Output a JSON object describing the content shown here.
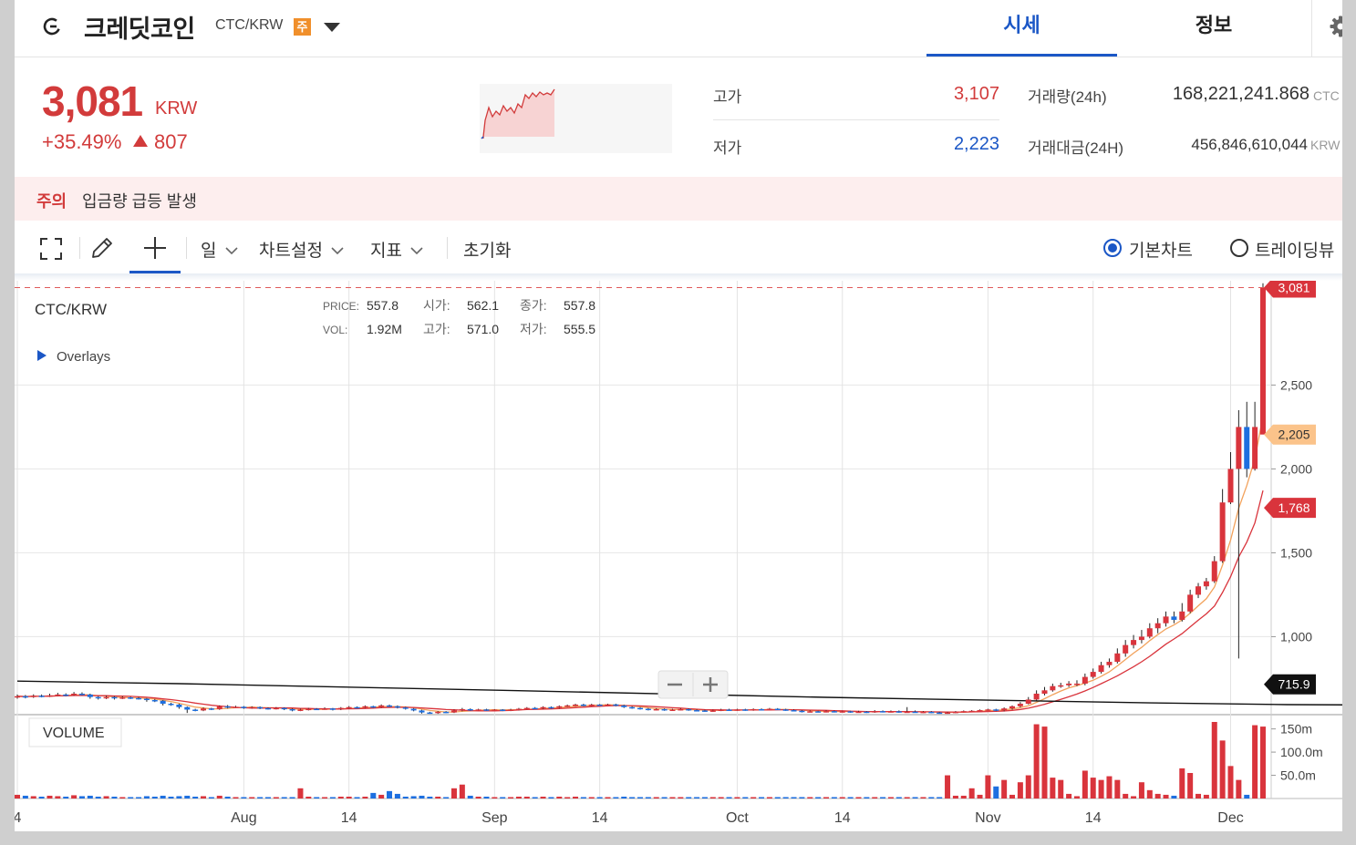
{
  "header": {
    "coin_name": "크레딧코인",
    "pair": "CTC/KRW",
    "warning_badge": "주",
    "tab_price": "시세",
    "tab_info": "정보"
  },
  "price": {
    "current": "3,081",
    "unit": "KRW",
    "change_pct": "+35.49%",
    "change_abs": "807",
    "up_color": "#d23b3b",
    "down_color": "#1b57c6"
  },
  "stats": {
    "high_label": "고가",
    "high_value": "3,107",
    "low_label": "저가",
    "low_value": "2,223",
    "volume_label": "거래량(24h)",
    "volume_value": "168,221,241.868",
    "volume_unit": "CTC",
    "amount_label": "거래대금(24H)",
    "amount_value": "456,846,610,044",
    "amount_unit": "KRW"
  },
  "alert": {
    "tag": "주의",
    "text": "입금량 급등 발생"
  },
  "toolbar": {
    "period": "일",
    "chart_settings": "차트설정",
    "indicators": "지표",
    "reset": "초기화",
    "basic_chart": "기본차트",
    "trading_view": "트레이딩뷰"
  },
  "legend": {
    "symbol": "CTC/KRW",
    "overlays": "Overlays",
    "price_label": "PRICE:",
    "price_value": "557.8",
    "open_label": "시가:",
    "open_value": "562.1",
    "close_label": "종가:",
    "close_value": "557.8",
    "vol_label": "VOL:",
    "vol_value": "1.92M",
    "high_label": "고가:",
    "high_value": "571.0",
    "low_label": "저가:",
    "low_value": "555.5",
    "volume_pane": "VOLUME"
  },
  "chart_data": {
    "type": "candlestick",
    "title": "CTC/KRW",
    "y_ticks": [
      1000,
      1500,
      2000,
      2500
    ],
    "y_tick_labels": [
      "1,000",
      "1,500",
      "2,000",
      "2,500"
    ],
    "y_range": [
      535,
      3100
    ],
    "x_tick_labels": [
      "4",
      "Aug",
      "14",
      "Sep",
      "14",
      "Oct",
      "14",
      "Nov",
      "14",
      "Dec"
    ],
    "x_tick_dates": [
      "2022-07-04",
      "2022-08-01",
      "2022-08-14",
      "2022-09-01",
      "2022-09-14",
      "2022-10-01",
      "2022-10-14",
      "2022-11-01",
      "2022-11-14",
      "2022-12-01"
    ],
    "start_date": "2022-07-04",
    "price_markers": [
      {
        "value": 3081,
        "label": "3,081",
        "color": "#d9343c"
      },
      {
        "value": 2205,
        "label": "2,205",
        "color": "#fbc38a"
      },
      {
        "value": 1768,
        "label": "1,768",
        "color": "#d9343c"
      },
      {
        "value": 715.9,
        "label": "715.9",
        "color": "#111111"
      }
    ],
    "volume_ticks": [
      "150m",
      "100.0m",
      "50.0m"
    ],
    "volume_max": 165,
    "series_colors": {
      "up": "#d9343c",
      "down": "#1d6fe0",
      "ma_short": "#f2a25c",
      "ma_mid": "#d9343c",
      "ma_long": "#111111"
    },
    "ma_long": [
      [
        0,
        735
      ],
      [
        20,
        720
      ],
      [
        60,
        680
      ],
      [
        100,
        638
      ],
      [
        140,
        605
      ],
      [
        157,
        595
      ],
      [
        170,
        592
      ],
      [
        180,
        600
      ],
      [
        190,
        625
      ],
      [
        195,
        655
      ],
      [
        198,
        680
      ],
      [
        200,
        716
      ]
    ],
    "candles": [
      [
        0,
        640,
        645,
        655,
        630,
        8
      ],
      [
        1,
        645,
        640,
        652,
        632,
        6
      ],
      [
        2,
        640,
        648,
        656,
        635,
        5
      ],
      [
        3,
        648,
        643,
        655,
        638,
        4
      ],
      [
        4,
        643,
        650,
        660,
        640,
        6
      ],
      [
        5,
        650,
        655,
        665,
        645,
        5
      ],
      [
        6,
        655,
        652,
        662,
        645,
        4
      ],
      [
        7,
        652,
        660,
        670,
        648,
        7
      ],
      [
        8,
        660,
        655,
        668,
        650,
        5
      ],
      [
        9,
        655,
        640,
        660,
        630,
        6
      ],
      [
        10,
        640,
        635,
        646,
        625,
        4
      ],
      [
        11,
        635,
        640,
        648,
        628,
        5
      ],
      [
        12,
        640,
        632,
        645,
        625,
        4
      ],
      [
        13,
        632,
        638,
        644,
        628,
        3
      ],
      [
        14,
        638,
        634,
        642,
        628,
        3
      ],
      [
        15,
        634,
        630,
        640,
        625,
        3
      ],
      [
        16,
        630,
        622,
        634,
        612,
        5
      ],
      [
        17,
        622,
        618,
        628,
        610,
        4
      ],
      [
        18,
        618,
        600,
        622,
        590,
        6
      ],
      [
        19,
        600,
        595,
        606,
        588,
        4
      ],
      [
        20,
        595,
        580,
        600,
        570,
        5
      ],
      [
        21,
        580,
        565,
        584,
        545,
        6
      ],
      [
        22,
        565,
        560,
        570,
        555,
        4
      ],
      [
        23,
        560,
        572,
        578,
        556,
        5
      ],
      [
        24,
        572,
        568,
        576,
        562,
        3
      ],
      [
        25,
        568,
        585,
        590,
        564,
        6
      ],
      [
        26,
        585,
        578,
        592,
        572,
        4
      ],
      [
        27,
        578,
        582,
        588,
        574,
        3
      ],
      [
        28,
        582,
        575,
        586,
        570,
        3
      ],
      [
        29,
        575,
        580,
        585,
        570,
        3
      ],
      [
        30,
        580,
        574,
        584,
        568,
        3
      ],
      [
        31,
        574,
        570,
        578,
        565,
        3
      ],
      [
        32,
        570,
        575,
        580,
        566,
        3
      ],
      [
        33,
        575,
        568,
        578,
        562,
        3
      ],
      [
        34,
        568,
        560,
        572,
        555,
        3
      ],
      [
        35,
        560,
        565,
        570,
        556,
        22
      ],
      [
        36,
        565,
        570,
        575,
        560,
        4
      ],
      [
        37,
        570,
        568,
        574,
        563,
        3
      ],
      [
        38,
        568,
        572,
        578,
        564,
        3
      ],
      [
        39,
        572,
        566,
        575,
        560,
        3
      ],
      [
        40,
        566,
        575,
        580,
        562,
        4
      ],
      [
        41,
        575,
        580,
        586,
        570,
        4
      ],
      [
        42,
        580,
        578,
        584,
        572,
        3
      ],
      [
        43,
        578,
        585,
        590,
        574,
        4
      ],
      [
        44,
        585,
        580,
        588,
        575,
        12
      ],
      [
        45,
        580,
        590,
        596,
        576,
        8
      ],
      [
        46,
        590,
        585,
        595,
        580,
        16
      ],
      [
        47,
        585,
        578,
        590,
        572,
        10
      ],
      [
        48,
        578,
        570,
        582,
        565,
        4
      ],
      [
        49,
        570,
        560,
        574,
        555,
        5
      ],
      [
        50,
        560,
        548,
        564,
        542,
        6
      ],
      [
        51,
        548,
        545,
        552,
        540,
        4
      ],
      [
        52,
        545,
        552,
        556,
        540,
        4
      ],
      [
        53,
        552,
        548,
        556,
        544,
        3
      ],
      [
        54,
        548,
        560,
        565,
        545,
        22
      ],
      [
        55,
        560,
        568,
        575,
        555,
        30
      ],
      [
        56,
        568,
        562,
        572,
        558,
        6
      ],
      [
        57,
        562,
        566,
        570,
        558,
        4
      ],
      [
        58,
        566,
        562,
        570,
        558,
        4
      ],
      [
        59,
        562,
        565,
        568,
        558,
        3
      ],
      [
        60,
        565,
        560,
        568,
        556,
        3
      ],
      [
        61,
        560,
        565,
        570,
        556,
        3
      ],
      [
        62,
        565,
        570,
        575,
        560,
        4
      ],
      [
        63,
        570,
        575,
        580,
        566,
        4
      ],
      [
        64,
        575,
        572,
        580,
        568,
        3
      ],
      [
        65,
        572,
        580,
        585,
        568,
        4
      ],
      [
        66,
        580,
        576,
        584,
        570,
        3
      ],
      [
        67,
        576,
        585,
        590,
        572,
        4
      ],
      [
        68,
        585,
        590,
        595,
        580,
        3
      ],
      [
        69,
        590,
        595,
        600,
        585,
        4
      ],
      [
        70,
        595,
        590,
        600,
        585,
        3
      ],
      [
        71,
        590,
        595,
        600,
        585,
        3
      ],
      [
        72,
        595,
        592,
        598,
        588,
        3
      ],
      [
        73,
        592,
        596,
        600,
        588,
        3
      ],
      [
        74,
        596,
        590,
        600,
        585,
        3
      ],
      [
        75,
        590,
        580,
        594,
        575,
        4
      ],
      [
        76,
        580,
        575,
        585,
        570,
        3
      ],
      [
        77,
        575,
        570,
        580,
        565,
        3
      ],
      [
        78,
        570,
        565,
        575,
        560,
        3
      ],
      [
        79,
        565,
        568,
        574,
        560,
        3
      ],
      [
        80,
        568,
        562,
        572,
        558,
        3
      ],
      [
        81,
        562,
        565,
        570,
        558,
        3
      ],
      [
        82,
        565,
        568,
        572,
        560,
        3
      ],
      [
        83,
        568,
        562,
        572,
        558,
        3
      ],
      [
        84,
        562,
        560,
        566,
        555,
        3
      ],
      [
        85,
        560,
        556,
        564,
        552,
        3
      ],
      [
        86,
        556,
        560,
        564,
        552,
        3
      ],
      [
        87,
        560,
        565,
        570,
        556,
        3
      ],
      [
        88,
        565,
        562,
        570,
        558,
        3
      ],
      [
        89,
        562,
        566,
        570,
        558,
        3
      ],
      [
        90,
        566,
        562,
        570,
        558,
        3
      ],
      [
        91,
        562,
        568,
        572,
        558,
        3
      ],
      [
        92,
        568,
        565,
        572,
        560,
        3
      ],
      [
        93,
        565,
        570,
        575,
        562,
        3
      ],
      [
        94,
        570,
        566,
        574,
        562,
        3
      ],
      [
        95,
        566,
        562,
        570,
        558,
        3
      ],
      [
        96,
        562,
        558,
        566,
        554,
        3
      ],
      [
        97,
        558,
        552,
        562,
        548,
        3
      ],
      [
        98,
        552,
        555,
        560,
        548,
        3
      ],
      [
        99,
        555,
        552,
        558,
        548,
        3
      ],
      [
        100,
        552,
        556,
        560,
        548,
        3
      ],
      [
        101,
        556,
        552,
        560,
        548,
        3
      ],
      [
        102,
        552,
        555,
        558,
        548,
        3
      ],
      [
        103,
        555,
        550,
        558,
        546,
        3
      ],
      [
        104,
        550,
        553,
        558,
        546,
        3
      ],
      [
        105,
        553,
        550,
        556,
        545,
        3
      ],
      [
        106,
        550,
        556,
        562,
        546,
        3
      ],
      [
        107,
        556,
        552,
        560,
        548,
        3
      ],
      [
        108,
        552,
        555,
        560,
        548,
        3
      ],
      [
        109,
        555,
        551,
        560,
        546,
        3
      ],
      [
        110,
        551,
        553,
        580,
        546,
        3
      ],
      [
        111,
        553,
        549,
        560,
        546,
        3
      ],
      [
        112,
        549,
        552,
        556,
        545,
        3
      ],
      [
        113,
        552,
        548,
        556,
        544,
        3
      ],
      [
        114,
        548,
        545,
        552,
        540,
        3
      ],
      [
        115,
        545,
        548,
        552,
        540,
        50
      ],
      [
        116,
        548,
        552,
        556,
        544,
        6
      ],
      [
        117,
        552,
        556,
        560,
        548,
        6
      ],
      [
        118,
        556,
        558,
        562,
        552,
        22
      ],
      [
        119,
        558,
        562,
        566,
        554,
        8
      ],
      [
        120,
        562,
        566,
        570,
        558,
        50
      ],
      [
        121,
        566,
        560,
        570,
        556,
        26
      ],
      [
        122,
        560,
        572,
        578,
        555,
        40
      ],
      [
        123,
        572,
        585,
        590,
        565,
        8
      ],
      [
        124,
        585,
        600,
        610,
        578,
        35
      ],
      [
        125,
        600,
        625,
        640,
        596,
        50
      ],
      [
        126,
        625,
        660,
        680,
        618,
        160
      ],
      [
        127,
        660,
        680,
        700,
        650,
        155
      ],
      [
        128,
        680,
        705,
        720,
        672,
        45
      ],
      [
        129,
        705,
        710,
        725,
        695,
        40
      ],
      [
        130,
        710,
        720,
        735,
        700,
        10
      ],
      [
        131,
        720,
        720,
        740,
        705,
        5
      ],
      [
        132,
        720,
        760,
        780,
        710,
        60
      ],
      [
        133,
        760,
        790,
        810,
        750,
        45
      ],
      [
        134,
        790,
        830,
        850,
        780,
        40
      ],
      [
        135,
        830,
        850,
        870,
        815,
        48
      ],
      [
        136,
        850,
        900,
        930,
        840,
        40
      ],
      [
        137,
        900,
        950,
        980,
        880,
        10
      ],
      [
        138,
        950,
        980,
        1010,
        930,
        5
      ],
      [
        139,
        980,
        1000,
        1040,
        960,
        35
      ],
      [
        140,
        1000,
        1050,
        1080,
        990,
        18
      ],
      [
        141,
        1050,
        1080,
        1110,
        1020,
        10
      ],
      [
        142,
        1080,
        1120,
        1150,
        1060,
        8
      ],
      [
        143,
        1120,
        1100,
        1150,
        1080,
        6
      ],
      [
        144,
        1100,
        1150,
        1200,
        1090,
        65
      ],
      [
        145,
        1150,
        1250,
        1280,
        1140,
        55
      ],
      [
        146,
        1250,
        1300,
        1320,
        1230,
        10
      ],
      [
        147,
        1300,
        1330,
        1350,
        1280,
        8
      ],
      [
        148,
        1330,
        1450,
        1480,
        1320,
        165
      ],
      [
        149,
        1450,
        1800,
        1880,
        1440,
        125
      ],
      [
        150,
        1800,
        2000,
        2100,
        1790,
        70
      ],
      [
        151,
        2000,
        2250,
        2350,
        870,
        40
      ],
      [
        152,
        2250,
        2000,
        2400,
        1950,
        8
      ],
      [
        153,
        2000,
        2250,
        2400,
        1990,
        158
      ],
      [
        154,
        2205,
        3081,
        3107,
        2223,
        155
      ]
    ]
  }
}
